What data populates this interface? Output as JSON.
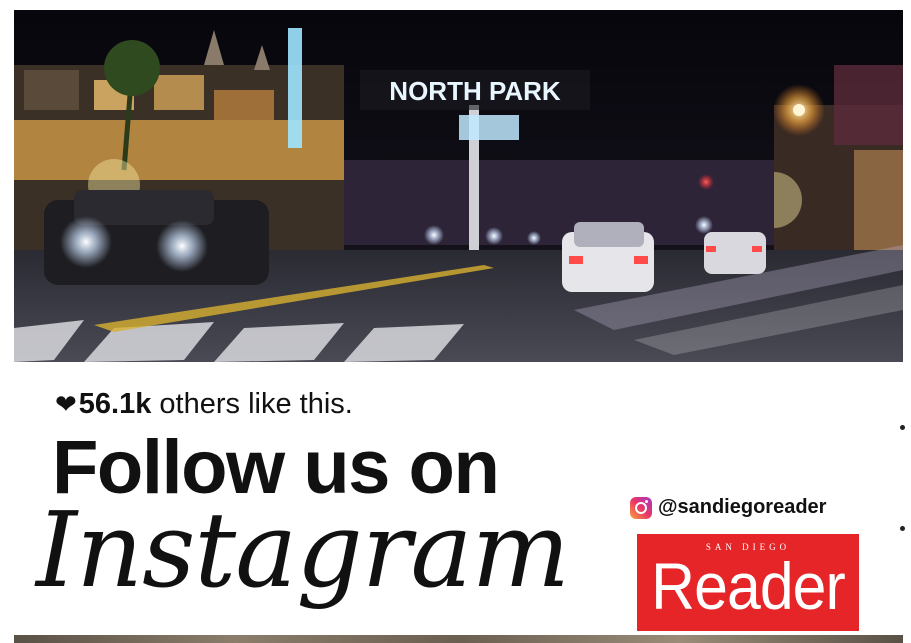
{
  "photo": {
    "sign_text": "NORTH PARK"
  },
  "likes": {
    "heart_icon": "heart-icon",
    "count": "56.1k",
    "suffix": " others like this."
  },
  "headline": {
    "line1": "Follow us on",
    "line2": "Instagram"
  },
  "social": {
    "icon": "instagram-icon",
    "handle": "@sandiegoreader"
  },
  "logo": {
    "small_text": "SAN DIEGO",
    "big_text": "Reader",
    "color": "#e52528"
  }
}
